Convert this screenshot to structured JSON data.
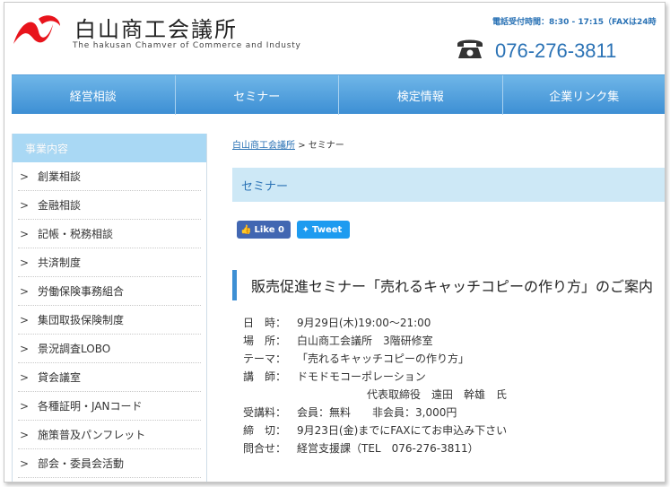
{
  "header": {
    "org_name": "白山商工会議所",
    "org_en": "The hakusan Chamver of Commerce and Industy",
    "hours": "電話受付時間：8:30 - 17:15（FAXは24時",
    "phone": "076-276-3811"
  },
  "nav": [
    "経営相談",
    "セミナー",
    "検定情報",
    "企業リンク集"
  ],
  "sidebar": {
    "title": "事業内容",
    "items": [
      "創業相談",
      "金融相談",
      "記帳・税務相談",
      "共済制度",
      "労働保険事務組合",
      "集団取扱保険制度",
      "景況調査LOBO",
      "貸会議室",
      "各種証明・JANコード",
      "施策普及パンフレット",
      "部会・委員会活動"
    ]
  },
  "breadcrumb": {
    "home": "白山商工会議所",
    "sep": ">",
    "current": "セミナー"
  },
  "page_heading": "セミナー",
  "social": {
    "like": "Like 0",
    "tweet": "Tweet"
  },
  "article": {
    "title": "販売促進セミナー「売れるキャッチコピーの作り方」のご案内",
    "rows": [
      {
        "label": "日　時：",
        "value": "9月29日(木)19:00～21:00"
      },
      {
        "label": "場　所：",
        "value": "白山商工会議所　3階研修室"
      },
      {
        "label": "テーマ：",
        "value": "「売れるキャッチコピーの作り方」"
      },
      {
        "label": "講　師：",
        "value": "ドモドモコーポレーション"
      },
      {
        "label": "",
        "value": "代表取締役　遠田　幹雄　氏"
      },
      {
        "label": "受講料：",
        "value": "会員：無料　　非会員：3,000円"
      },
      {
        "label": "締　切：",
        "value": "9月23日(金)までにFAXにてお申込み下さい"
      },
      {
        "label": "問合せ：",
        "value": "経営支援課（TEL　076-276-3811）"
      }
    ]
  },
  "colors": {
    "accent": "#2a72b5",
    "nav": "#3d8fd4",
    "logo": "#e8141c"
  }
}
